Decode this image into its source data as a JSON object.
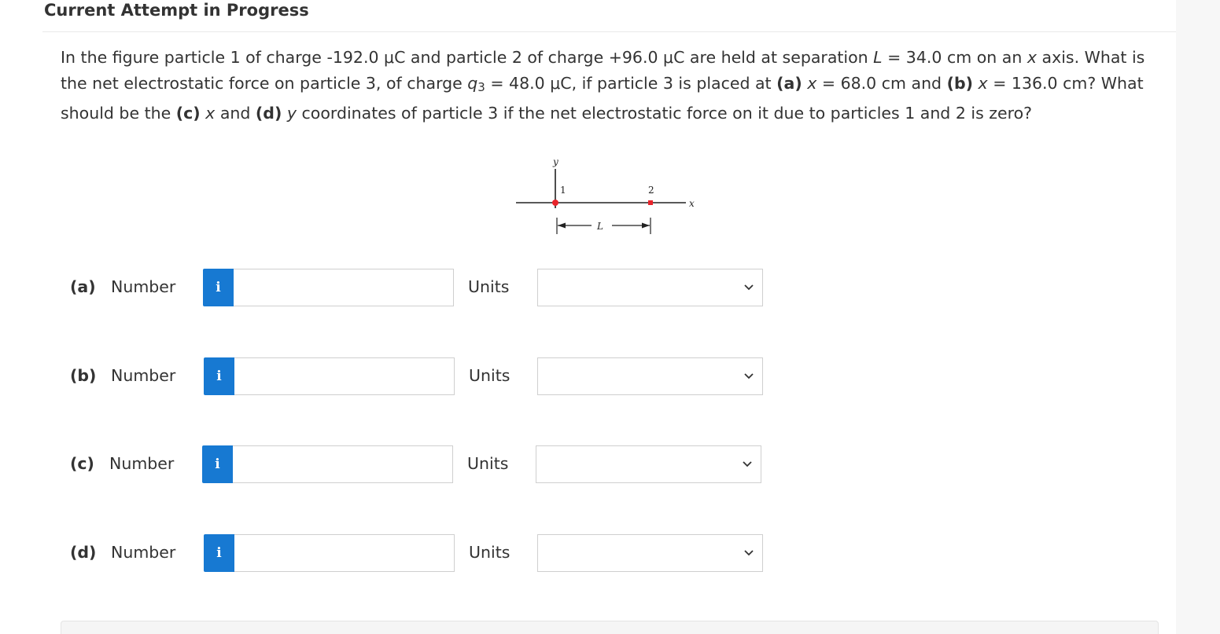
{
  "header": {
    "title": "Current Attempt in Progress"
  },
  "question": {
    "s1": "In the figure particle 1 of charge -192.0 μC and particle 2 of charge +96.0 μC are held at separation ",
    "L_var": "L",
    "s2": " = 34.0 cm on an ",
    "x_var1": "x",
    "s3": " axis. What is the net electrostatic force on particle 3, of charge ",
    "q_var": "q",
    "q_sub": "3",
    "s4": " = 48.0 μC, if particle 3 is placed at ",
    "a_tag": "(a)",
    "s5": " ",
    "x_var2": "x",
    "s6": " = 68.0 cm and ",
    "b_tag": "(b)",
    "s7": " ",
    "x_var3": "x",
    "s8": " = 136.0 cm? What should be the ",
    "c_tag": "(c)",
    "s9": " ",
    "x_var4": "x",
    "s10": " and ",
    "d_tag": "(d)",
    "s11": " ",
    "y_var": "y",
    "s12": " coordinates of particle 3 if the net electrostatic force on it due to particles 1 and 2 is zero?"
  },
  "figure": {
    "y_axis_label": "y",
    "x_axis_label": "x",
    "particle1_label": "1",
    "particle2_label": "2",
    "separation_label": "L",
    "particle_color": "#e8232a"
  },
  "answers": [
    {
      "part": "(a)",
      "number_label": "Number",
      "info_icon": "i",
      "value": "",
      "units_label": "Units",
      "units_value": ""
    },
    {
      "part": "(b)",
      "number_label": "Number",
      "info_icon": "i",
      "value": "",
      "units_label": "Units",
      "units_value": ""
    },
    {
      "part": "(c)",
      "number_label": "Number",
      "info_icon": "i",
      "value": "",
      "units_label": "Units",
      "units_value": ""
    },
    {
      "part": "(d)",
      "number_label": "Number",
      "info_icon": "i",
      "value": "",
      "units_label": "Units",
      "units_value": ""
    }
  ],
  "colors": {
    "info_button": "#1779d2",
    "text": "#333333",
    "border": "#cfcfcf"
  }
}
